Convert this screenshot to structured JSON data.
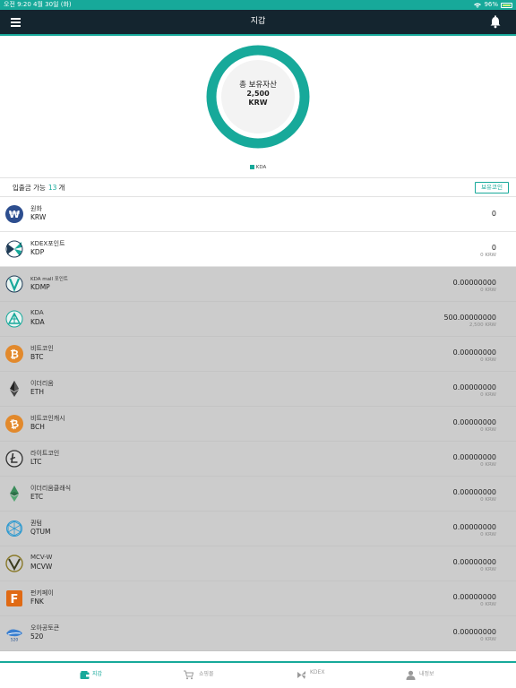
{
  "status": {
    "left": "오전 9:20  4월 30일 (화)",
    "right": "96%"
  },
  "nav": {
    "title": "지갑"
  },
  "summary": {
    "label": "총 보유자산",
    "value": "2,500",
    "currency": "KRW",
    "legend": "KDA",
    "ring_color": "#17a99a"
  },
  "count_row": {
    "label": "입출금 가능",
    "count": "13",
    "unit": "개",
    "button": "보유코인"
  },
  "coins": [
    {
      "name": "원화",
      "symbol": "KRW",
      "amount": "0",
      "krw": "",
      "icon": "won-icon",
      "style": "white"
    },
    {
      "name": "KDEX포인트",
      "symbol": "KDP",
      "amount": "0",
      "krw": "0 KRW",
      "icon": "kdp-icon",
      "style": "white"
    },
    {
      "name": "KDA mall 포인트",
      "symbol": "KDMP",
      "amount": "0.00000000",
      "krw": "0 KRW",
      "icon": "kdmp-icon",
      "style": "gray"
    },
    {
      "name": "KDA",
      "symbol": "KDA",
      "amount": "500.00000000",
      "krw": "2,500 KRW",
      "icon": "kda-icon",
      "style": "gray"
    },
    {
      "name": "비트코인",
      "symbol": "BTC",
      "amount": "0.00000000",
      "krw": "0 KRW",
      "icon": "bitcoin-icon",
      "style": "gray"
    },
    {
      "name": "이더리움",
      "symbol": "ETH",
      "amount": "0.00000000",
      "krw": "0 KRW",
      "icon": "ethereum-icon",
      "style": "gray"
    },
    {
      "name": "비트코인캐시",
      "symbol": "BCH",
      "amount": "0.00000000",
      "krw": "0 KRW",
      "icon": "bitcoin-cash-icon",
      "style": "gray"
    },
    {
      "name": "라이트코인",
      "symbol": "LTC",
      "amount": "0.00000000",
      "krw": "0 KRW",
      "icon": "litecoin-icon",
      "style": "gray"
    },
    {
      "name": "이더리움클래식",
      "symbol": "ETC",
      "amount": "0.00000000",
      "krw": "0 KRW",
      "icon": "ethereum-classic-icon",
      "style": "gray"
    },
    {
      "name": "퀀텀",
      "symbol": "QTUM",
      "amount": "0.00000000",
      "krw": "0 KRW",
      "icon": "qtum-icon",
      "style": "gray"
    },
    {
      "name": "MCV-W",
      "symbol": "MCVW",
      "amount": "0.00000000",
      "krw": "0 KRW",
      "icon": "mcvw-icon",
      "style": "gray"
    },
    {
      "name": "펀키페이",
      "symbol": "FNK",
      "amount": "0.00000000",
      "krw": "0 KRW",
      "icon": "funkeypay-icon",
      "style": "gray"
    },
    {
      "name": "오아공토큰",
      "symbol": "520",
      "amount": "0.00000000",
      "krw": "0 KRW",
      "icon": "token-520-icon",
      "style": "gray"
    }
  ],
  "tabs": [
    {
      "label": "지갑",
      "icon": "wallet-icon",
      "active": true
    },
    {
      "label": "쇼핑몰",
      "icon": "cart-icon",
      "active": false
    },
    {
      "label": "KDEX",
      "icon": "kdex-icon",
      "active": false
    },
    {
      "label": "내정보",
      "icon": "profile-icon",
      "active": false
    }
  ]
}
